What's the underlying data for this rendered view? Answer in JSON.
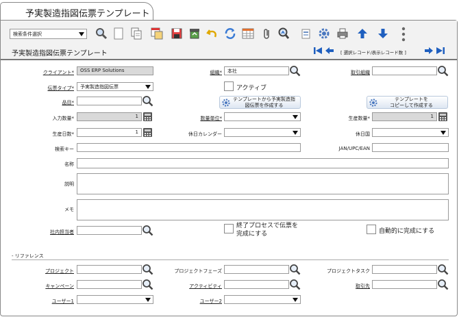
{
  "window": {
    "tab_title": "予実製造指図伝票テンプレート"
  },
  "toolbar": {
    "search_condition": "検索条件選択",
    "icons": [
      "search-icon",
      "new-doc-icon",
      "copy-icon",
      "report-icon",
      "save-icon",
      "delete-icon",
      "undo-icon",
      "refresh-icon",
      "grid-icon",
      "attach-icon",
      "zoom-icon",
      "history-icon",
      "settings-icon",
      "print-icon",
      "arrow-up-icon",
      "arrow-down-icon",
      "more-icon"
    ],
    "page_title": "予実製造指図伝票テンプレート",
    "record_info": "[ 選択レコード/表示レコード数 ]"
  },
  "form": {
    "client": {
      "label": "クライアント",
      "value": "OSS ERP Solutions"
    },
    "org": {
      "label": "組織",
      "value": "本社"
    },
    "trade_org": {
      "label": "取引組織",
      "value": ""
    },
    "doc_type": {
      "label": "伝票タイプ",
      "value": "予実製造指図伝票"
    },
    "active": {
      "label": "アクティブ"
    },
    "product": {
      "label": "品目",
      "value": ""
    },
    "btn_create_from_template": {
      "line1": "テンプレートから予実製造指",
      "line2": "図伝票を作成する"
    },
    "btn_copy_template": {
      "line1": "テンプレートを",
      "line2": "コピーして作成する"
    },
    "input_qty": {
      "label": "入力数量",
      "value": "1"
    },
    "uom": {
      "label": "数量単位",
      "value": ""
    },
    "production_qty": {
      "label": "生産数量",
      "value": "1"
    },
    "production_days": {
      "label": "生産日数",
      "value": "1"
    },
    "holiday_calendar": {
      "label": "休日カレンダー",
      "value": ""
    },
    "holiday_country": {
      "label": "休日国",
      "value": ""
    },
    "search_key": {
      "label": "検索キー",
      "value": ""
    },
    "jan": {
      "label": "JAN/UPC/EAN",
      "value": ""
    },
    "name": {
      "label": "名称",
      "value": ""
    },
    "description": {
      "label": "説明",
      "value": ""
    },
    "memo": {
      "label": "メモ",
      "value": ""
    },
    "staff": {
      "label": "社内担当者",
      "value": ""
    },
    "complete_on_end": {
      "label1": "終了プロセスで伝票を",
      "label2": "完成にする"
    },
    "auto_complete": {
      "label": "自動的に完成にする"
    }
  },
  "reference": {
    "section_title": "- リファレンス",
    "project": {
      "label": "プロジェクト"
    },
    "project_phase": {
      "label": "プロジェクトフェーズ"
    },
    "project_task": {
      "label": "プロジェクトタスク"
    },
    "campaign": {
      "label": "キャンペーン"
    },
    "activity": {
      "label": "アクティビティ"
    },
    "bpartner": {
      "label": "取引先"
    },
    "user1": {
      "label": "ユーザー1"
    },
    "user2": {
      "label": "ユーザー2"
    }
  },
  "colors": {
    "nav_blue": "#1f5fbf",
    "header_bg": "#f2f2f2",
    "readonly_bg": "#d9d9d9"
  }
}
